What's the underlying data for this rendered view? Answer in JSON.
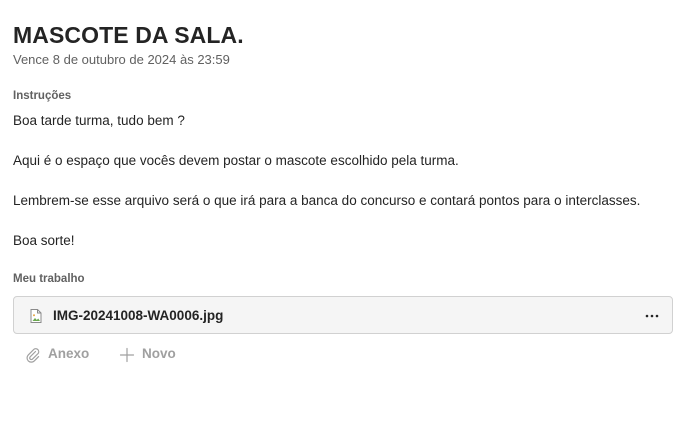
{
  "assignment": {
    "title": "MASCOTE DA SALA.",
    "due": "Vence 8 de outubro de 2024 às 23:59"
  },
  "instructions": {
    "label": "Instruções",
    "paragraphs": [
      "Boa tarde turma, tudo bem ?",
      "Aqui é o espaço que vocês devem postar o mascote escolhido pela turma.",
      "Lembrem-se esse arquivo será o que irá para a banca do concurso e contará pontos para o interclasses.",
      "Boa sorte!"
    ]
  },
  "my_work": {
    "label": "Meu trabalho",
    "files": [
      {
        "name": "IMG-20241008-WA0006.jpg",
        "icon": "image-file-icon"
      }
    ],
    "actions": {
      "attach_label": "Anexo",
      "new_label": "Novo"
    }
  },
  "colors": {
    "text": "#242424",
    "muted": "#616161",
    "disabled": "#a0a0a0",
    "card_bg": "#f5f5f5",
    "card_border": "#d1d1d1"
  }
}
